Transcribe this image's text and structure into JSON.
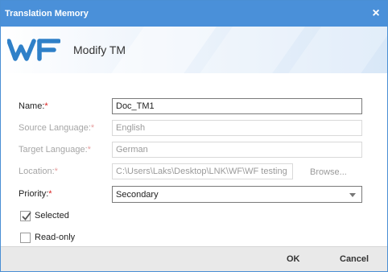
{
  "window": {
    "title": "Translation Memory",
    "close_glyph": "×"
  },
  "banner": {
    "heading": "Modify TM",
    "logo_icon": "wordfast-logo"
  },
  "form": {
    "name": {
      "label": "Name:",
      "required": "*",
      "value": "Doc_TM1"
    },
    "source_language": {
      "label": "Source Language:",
      "required": "*",
      "value": "English"
    },
    "target_language": {
      "label": "Target Language:",
      "required": "*",
      "value": "German"
    },
    "location": {
      "label": "Location:",
      "required": "*",
      "value": "C:\\Users\\Laks\\Desktop\\LNK\\WF\\WF testing",
      "browse_label": "Browse..."
    },
    "priority": {
      "label": "Priority:",
      "required": "*",
      "value": "Secondary"
    },
    "selected": {
      "label": "Selected",
      "checked": true
    },
    "read_only": {
      "label": "Read-only",
      "checked": false
    }
  },
  "footer": {
    "ok_label": "OK",
    "cancel_label": "Cancel"
  },
  "colors": {
    "titlebar": "#4a90d9",
    "required": "#d9201f",
    "logo_blue": "#2f80c8"
  }
}
